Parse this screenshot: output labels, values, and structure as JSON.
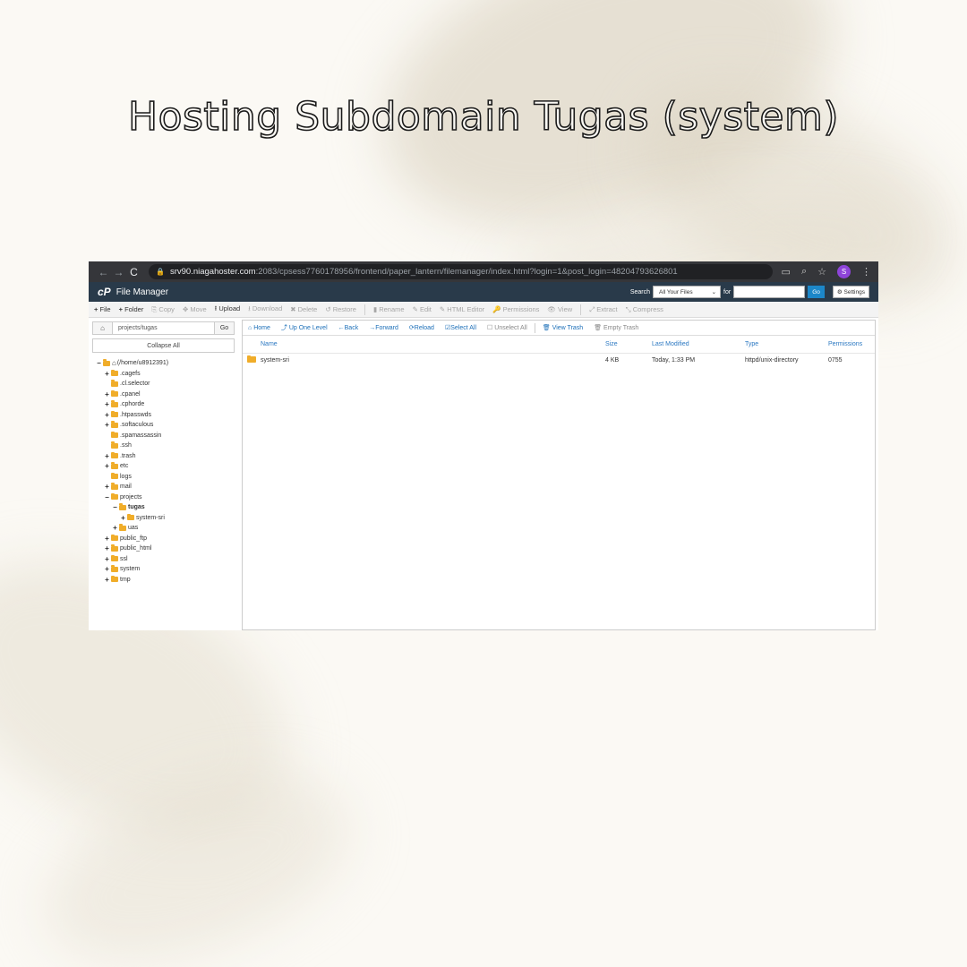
{
  "headline": "Hosting Subdomain Tugas (system)",
  "browser": {
    "url_host": "srv90.niagahoster.com",
    "url_rest": ":2083/cpsess7760178956/frontend/paper_lantern/filemanager/index.html?login=1&post_login=48204793626801",
    "avatar_letter": "S"
  },
  "cpanel": {
    "logo": "cP",
    "title": "File Manager",
    "search_label": "Search",
    "search_scope": "All Your Files",
    "for_label": "for",
    "go_label": "Go",
    "settings_label": "Settings"
  },
  "toolbar": {
    "items": [
      {
        "label": "File",
        "icon": "+",
        "enabled": true
      },
      {
        "label": "Folder",
        "icon": "+",
        "enabled": true
      },
      {
        "label": "Copy",
        "icon": "⎘",
        "enabled": false
      },
      {
        "label": "Move",
        "icon": "✥",
        "enabled": false
      },
      {
        "label": "Upload",
        "icon": "⭱",
        "enabled": true
      },
      {
        "label": "Download",
        "icon": "⭳",
        "enabled": false
      },
      {
        "label": "Delete",
        "icon": "✖",
        "enabled": false
      },
      {
        "label": "Restore",
        "icon": "↺",
        "enabled": false
      },
      {
        "label": "Rename",
        "icon": "▮",
        "enabled": false
      },
      {
        "label": "Edit",
        "icon": "✎",
        "enabled": false
      },
      {
        "label": "HTML Editor",
        "icon": "✎",
        "enabled": false
      },
      {
        "label": "Permissions",
        "icon": "🔑",
        "enabled": false
      },
      {
        "label": "View",
        "icon": "👁",
        "enabled": false
      },
      {
        "label": "Extract",
        "icon": "⤢",
        "enabled": false
      },
      {
        "label": "Compress",
        "icon": "⤡",
        "enabled": false
      }
    ]
  },
  "sidebar": {
    "path_value": "projects/tugas",
    "go_label": "Go",
    "collapse_label": "Collapse All",
    "tree": [
      {
        "label": "(/home/u8912391)",
        "toggle": "−",
        "depth": 0,
        "home": true
      },
      {
        "label": ".cagefs",
        "toggle": "+",
        "depth": 1
      },
      {
        "label": ".cl.selector",
        "toggle": "",
        "depth": 1
      },
      {
        "label": ".cpanel",
        "toggle": "+",
        "depth": 1
      },
      {
        "label": ".cphorde",
        "toggle": "+",
        "depth": 1
      },
      {
        "label": ".htpasswds",
        "toggle": "+",
        "depth": 1
      },
      {
        "label": ".softaculous",
        "toggle": "+",
        "depth": 1
      },
      {
        "label": ".spamassassin",
        "toggle": "",
        "depth": 1
      },
      {
        "label": ".ssh",
        "toggle": "",
        "depth": 1
      },
      {
        "label": ".trash",
        "toggle": "+",
        "depth": 1
      },
      {
        "label": "etc",
        "toggle": "+",
        "depth": 1
      },
      {
        "label": "logs",
        "toggle": "",
        "depth": 1
      },
      {
        "label": "mail",
        "toggle": "+",
        "depth": 1
      },
      {
        "label": "projects",
        "toggle": "−",
        "depth": 1
      },
      {
        "label": "tugas",
        "toggle": "−",
        "depth": 2,
        "bold": true
      },
      {
        "label": "system-sri",
        "toggle": "+",
        "depth": 3
      },
      {
        "label": "uas",
        "toggle": "+",
        "depth": 2
      },
      {
        "label": "public_ftp",
        "toggle": "+",
        "depth": 1
      },
      {
        "label": "public_html",
        "toggle": "+",
        "depth": 1
      },
      {
        "label": "ssl",
        "toggle": "+",
        "depth": 1
      },
      {
        "label": "system",
        "toggle": "+",
        "depth": 1
      },
      {
        "label": "tmp",
        "toggle": "+",
        "depth": 1
      }
    ]
  },
  "actions": {
    "home": "Home",
    "up": "Up One Level",
    "back": "Back",
    "forward": "Forward",
    "reload": "Reload",
    "select_all": "Select All",
    "unselect_all": "Unselect All",
    "view_trash": "View Trash",
    "empty_trash": "Empty Trash"
  },
  "table": {
    "headers": {
      "name": "Name",
      "size": "Size",
      "modified": "Last Modified",
      "type": "Type",
      "perms": "Permissions"
    },
    "rows": [
      {
        "name": "system-sri",
        "size": "4 KB",
        "modified": "Today, 1:33 PM",
        "type": "httpd/unix-directory",
        "perms": "0755"
      }
    ]
  },
  "colors": {
    "folder": "#f0ad2a",
    "header_bg": "#293a4a",
    "link": "#1c6fb8",
    "go_button": "#1c87c9"
  }
}
